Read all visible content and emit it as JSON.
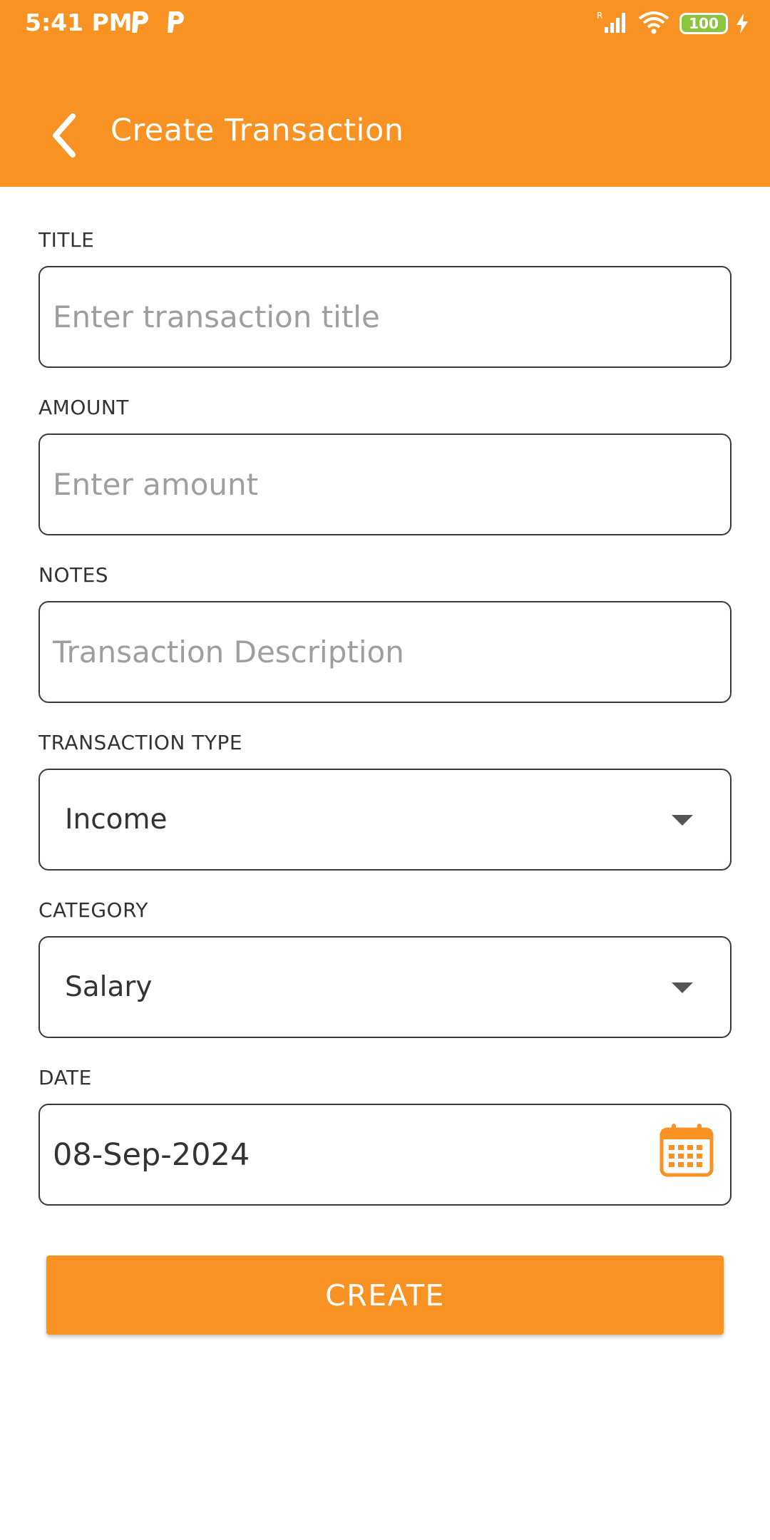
{
  "status_bar": {
    "time": "5:41 PM",
    "battery": "100",
    "icons": [
      "parking-p-icon",
      "parking-p-icon",
      "signal-icon",
      "wifi-icon",
      "battery-icon",
      "charging-icon"
    ]
  },
  "toolbar": {
    "title": "Create Transaction",
    "back_icon": "chevron-left-icon"
  },
  "form": {
    "title": {
      "label": "TITLE",
      "placeholder": "Enter transaction title"
    },
    "amount": {
      "label": "AMOUNT",
      "placeholder": "Enter amount"
    },
    "notes": {
      "label": "NOTES",
      "placeholder": "Transaction Description"
    },
    "transaction_type": {
      "label": "TRANSACTION TYPE",
      "value": "Income"
    },
    "category": {
      "label": "CATEGORY",
      "value": "Salary"
    },
    "date": {
      "label": "DATE",
      "value": "08-Sep-2024",
      "icon": "calendar-icon"
    }
  },
  "actions": {
    "create_label": "CREATE"
  },
  "colors": {
    "accent": "#f79223",
    "text": "#333333",
    "placeholder": "#9e9e9e"
  }
}
